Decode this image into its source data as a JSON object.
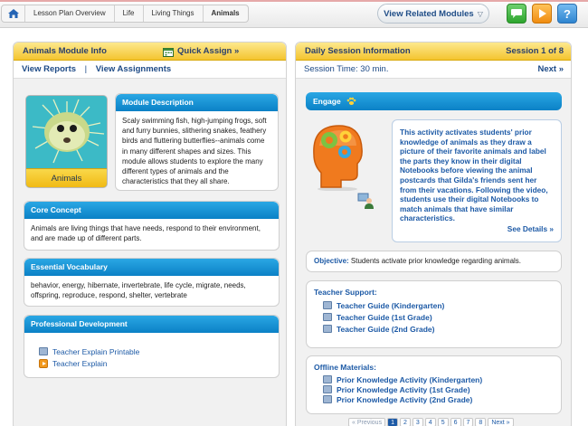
{
  "breadcrumb": {
    "items": [
      "Lesson Plan Overview",
      "Life",
      "Living Things",
      "Animals"
    ]
  },
  "header": {
    "related_label": "View Related Modules",
    "help_label": "?"
  },
  "left": {
    "title": "Animals Module Info",
    "quick_assign": "Quick Assign »",
    "view_reports": "View Reports",
    "separator": "|",
    "view_assignments": "View Assignments",
    "module_image_label": "Animals",
    "description_title": "Module Description",
    "description": "Scaly swimming fish, high-jumping frogs, soft and furry bunnies, slithering snakes, feathery birds and fluttering butterflies--animals come in many different shapes and sizes. This module allows students to explore the many different types of animals and the characteristics that they all share.",
    "core_title": "Core Concept",
    "core_text": "Animals are living things that have needs, respond to their environment, and are made up of different parts.",
    "vocab_title": "Essential Vocabulary",
    "vocab_text": "behavior, energy, hibernate, invertebrate, life cycle, migrate, needs, offspring, reproduce, respond, shelter, vertebrate",
    "pd_title": "Professional Development",
    "pd_links": [
      "Teacher Explain Printable",
      "Teacher Explain"
    ]
  },
  "right": {
    "title": "Daily Session Information",
    "session": "Session 1 of 8",
    "time": "Session Time: 30 min.",
    "next": "Next »",
    "engage_title": "Engage",
    "engage_text": "This activity activates students' prior knowledge of animals as they draw a picture of their favorite animals and label the parts they know in their digital Notebooks before viewing the animal postcards that Gilda's friends sent her from their vacations. Following the video, students use their digital Notebooks to match animals that have similar characteristics.",
    "see_details": "See Details »",
    "objective_label": "Objective:",
    "objective_text": "Students activate prior knowledge regarding animals.",
    "support_title": "Teacher Support:",
    "support_links": [
      "Teacher Guide (Kindergarten)",
      "Teacher Guide (1st Grade)",
      "Teacher Guide (2nd Grade)"
    ],
    "offline_title": "Offline Materials:",
    "offline_links": [
      "Prior Knowledge Activity (Kindergarten)",
      "Prior Knowledge Activity (1st Grade)",
      "Prior Knowledge Activity (2nd Grade)"
    ]
  },
  "pagination": {
    "prev": "« Previous",
    "pages": [
      "1",
      "2",
      "3",
      "4",
      "5",
      "6",
      "7",
      "8"
    ],
    "current": "1",
    "next": "Next »"
  },
  "colors": {
    "header_yellow": "#f4c430",
    "bar_blue": "#1496d6",
    "link_blue": "#1d5aa6",
    "chat_green": "#3db33d",
    "play_orange": "#f39a1e",
    "help_blue": "#2f8fd8"
  },
  "icons": {
    "home": "home-icon",
    "chat": "chat-icon",
    "play": "play-icon",
    "help": "help-icon"
  }
}
